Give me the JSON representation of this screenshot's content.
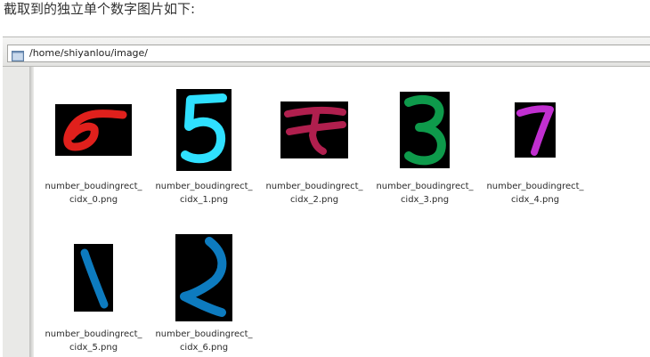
{
  "caption": "截取到的独立单个数字图片如下:",
  "location": {
    "icon": "folder-icon",
    "path": "/home/shiyanlou/image/"
  },
  "files": [
    {
      "line1": "number_boudingrect_",
      "line2": "cidx_0.png",
      "digit": "6",
      "color": "#e0201c"
    },
    {
      "line1": "number_boudingrect_",
      "line2": "cidx_1.png",
      "digit": "5",
      "color": "#2fe0ff"
    },
    {
      "line1": "number_boudingrect_",
      "line2": "cidx_2.png",
      "digit": "4",
      "color": "#b01f4e"
    },
    {
      "line1": "number_boudingrect_",
      "line2": "cidx_3.png",
      "digit": "3",
      "color": "#0e9a4b"
    },
    {
      "line1": "number_boudingrect_",
      "line2": "cidx_4.png",
      "digit": "7",
      "color": "#c12fd0"
    },
    {
      "line1": "number_boudingrect_",
      "line2": "cidx_5.png",
      "digit": "1",
      "color": "#0d7bbf"
    },
    {
      "line1": "number_boudingrect_",
      "line2": "cidx_6.png",
      "digit": "2",
      "color": "#0d7bbf"
    }
  ]
}
